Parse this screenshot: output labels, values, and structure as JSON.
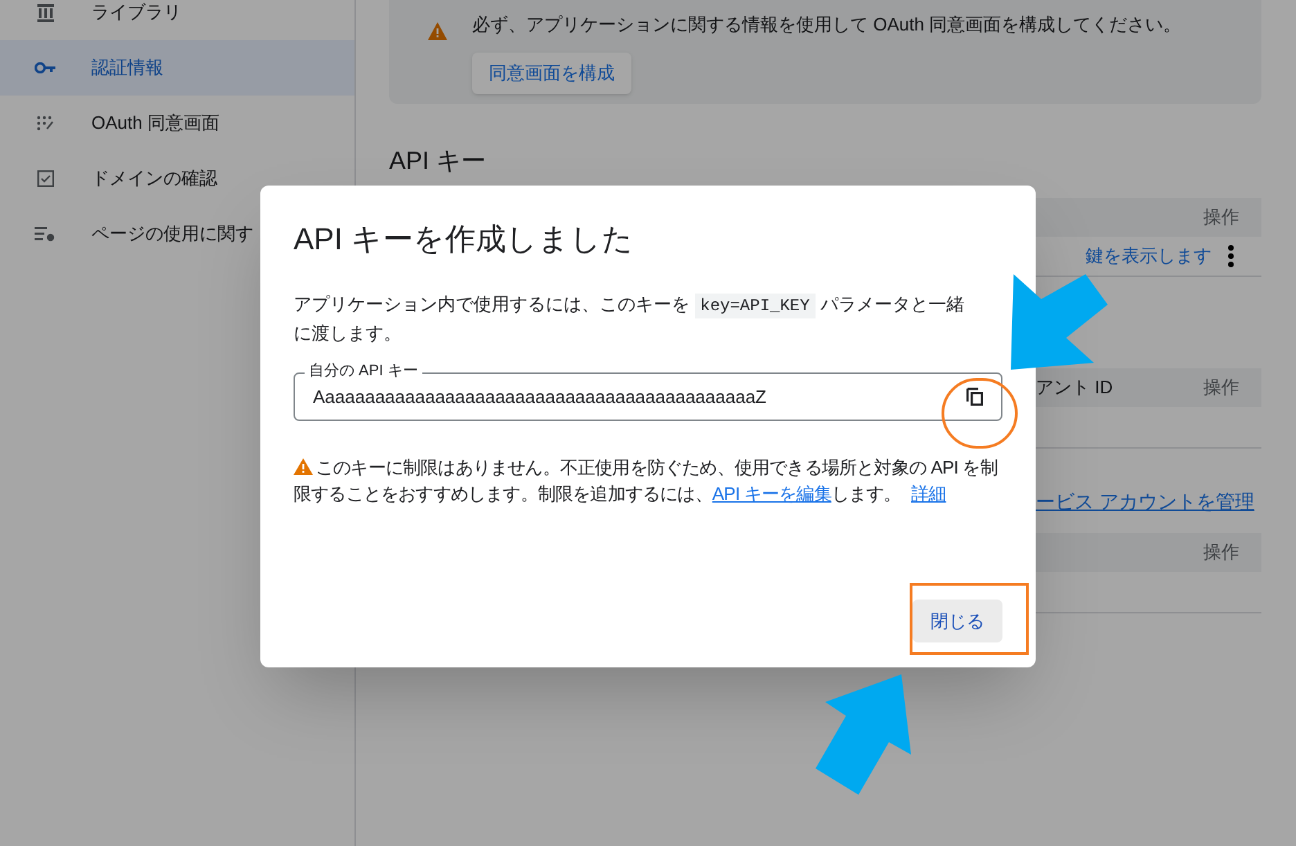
{
  "sidebar": {
    "items": [
      {
        "kind": "library",
        "label": "ライブラリ",
        "selected": false
      },
      {
        "kind": "key",
        "label": "認証情報",
        "selected": true
      },
      {
        "kind": "oauth",
        "label": "OAuth 同意画面",
        "selected": false
      },
      {
        "kind": "domain",
        "label": "ドメインの確認",
        "selected": false
      },
      {
        "kind": "page",
        "label": "ページの使用に関す",
        "selected": false
      }
    ]
  },
  "notice": {
    "text": "必ず、アプリケーションに関する情報を使用して OAuth 同意画面を構成してください。",
    "button": "同意画面を構成"
  },
  "api_keys": {
    "heading": "API キー",
    "column": "操作",
    "row_link": "鍵を表示します"
  },
  "oauth_clients": {
    "columns": [
      "アント ID",
      "操作"
    ]
  },
  "manage_link": "ービス アカウントを管理",
  "service_accounts": {
    "column": "操作"
  },
  "dialog": {
    "title": "API キーを作成しました",
    "body": {
      "before": "アプリケーション内で使用するには、このキーを ",
      "code": "key=API_KEY",
      "after": " パラメータと一緒に渡します。"
    },
    "field": {
      "label": "自分の API キー",
      "value": "AaaaaaaaaaaaaaaaaaaaaaaaaaaaaaaaaaaaaaaaaaaaZ"
    },
    "warning": {
      "text": "このキーに制限はありません。不正使用を防ぐため、使用できる場所と対象の API を制限することをおすすめします。制限を追加するには、",
      "link": "API キーを編集",
      "after": "します。",
      "more_link": "詳細"
    },
    "close_button": "閉じる"
  }
}
